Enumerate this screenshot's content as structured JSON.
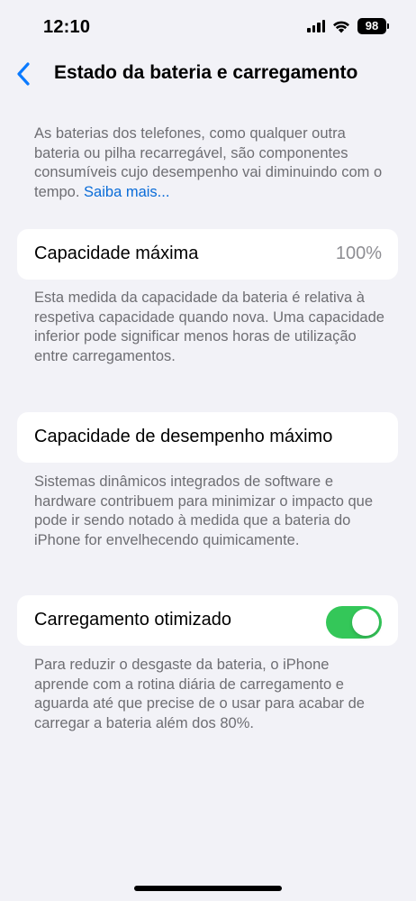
{
  "status_bar": {
    "time": "12:10",
    "battery_level": "98",
    "icons": [
      "signal-icon",
      "wifi-icon",
      "battery-icon"
    ]
  },
  "nav": {
    "back_icon": "chevron-left-icon",
    "title": "Estado da bateria e carregamento"
  },
  "intro": {
    "text": "As baterias dos telefones, como qualquer outra bateria ou pilha recarregável, são componentes consumíveis cujo desempenho vai diminuindo com o tempo.",
    "link_label": "Saiba mais..."
  },
  "max_capacity": {
    "label": "Capacidade máxima",
    "value": "100%",
    "footnote": "Esta medida da capacidade da bateria é relativa à respetiva capacidade quando nova. Uma capacidade inferior pode significar menos horas de utilização entre carregamentos."
  },
  "peak_performance": {
    "label": "Capacidade de desempenho máximo",
    "footnote": "Sistemas dinâmicos integrados de software e hardware contribuem para minimizar o impacto que pode ir sendo notado à medida que a bateria do iPhone for envelhecendo quimicamente."
  },
  "optimized_charging": {
    "label": "Carregamento otimizado",
    "enabled": true,
    "footnote": "Para reduzir o desgaste da bateria, o iPhone aprende com a rotina diária de carregamento e aguarda até que precise de o usar para acabar de carregar a bateria além dos 80%."
  },
  "colors": {
    "background": "#f2f2f7",
    "accent_blue": "#0a6cd8",
    "toggle_on": "#34c759",
    "secondary_text": "#6e6e73"
  }
}
